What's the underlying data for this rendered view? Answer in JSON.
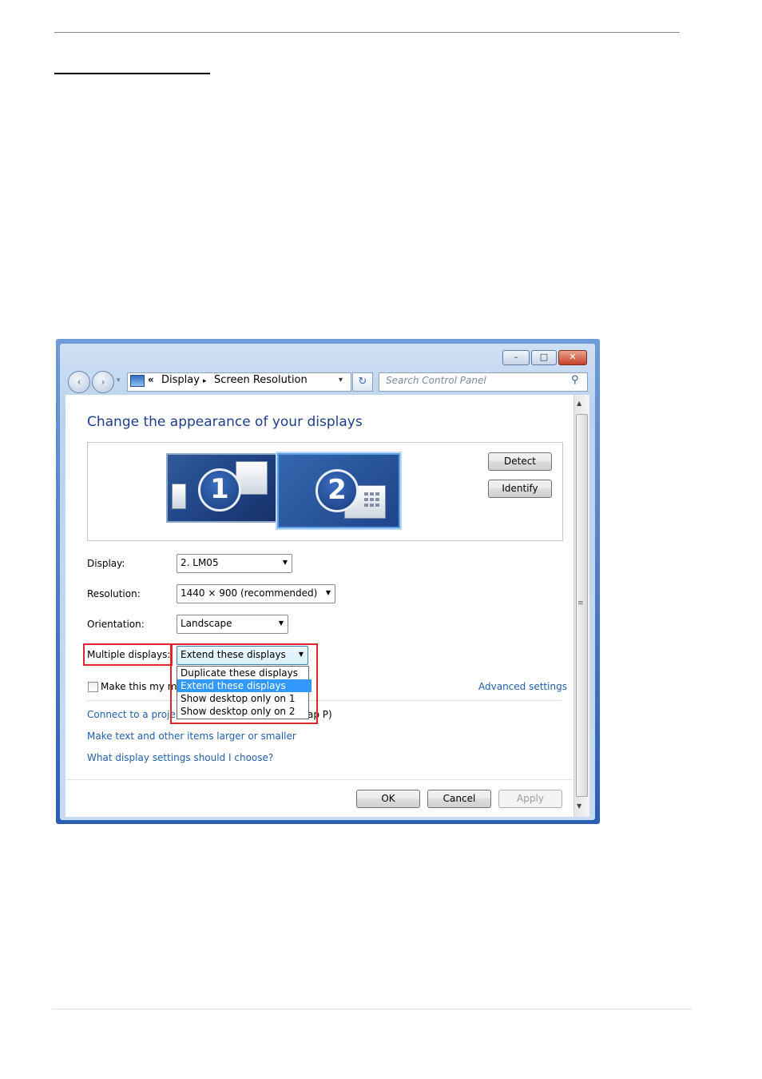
{
  "titlebar": {
    "minimize_glyph": "–",
    "maximize_glyph": "□",
    "close_glyph": "✕"
  },
  "nav": {
    "back_glyph": "‹",
    "forward_glyph": "›",
    "history_glyph": "▾",
    "breadcrumb_chevron": "«",
    "breadcrumb": [
      "Display",
      "Screen Resolution"
    ],
    "breadcrumb_separator": "▸",
    "address_dropdown_glyph": "▾",
    "refresh_glyph": "↻",
    "search_placeholder": "Search Control Panel",
    "search_glyph": "⚲"
  },
  "main": {
    "title": "Change the appearance of your displays",
    "monitors": [
      {
        "number": "1",
        "selected": false
      },
      {
        "number": "2",
        "selected": true
      }
    ],
    "detect_label": "Detect",
    "identify_label": "Identify"
  },
  "settings": {
    "display": {
      "label": "Display:",
      "value": "2. LM05"
    },
    "resolution": {
      "label": "Resolution:",
      "value": "1440 × 900 (recommended)"
    },
    "orientation": {
      "label": "Orientation:",
      "value": "Landscape"
    },
    "multiple_displays": {
      "label": "Multiple displays:",
      "value": "Extend these displays",
      "options": [
        "Duplicate these displays",
        "Extend these displays",
        "Show desktop only on 1",
        "Show desktop only on 2"
      ],
      "highlighted_index": 1
    },
    "select_arrow": "▼"
  },
  "checkbox_label": "Make this my ma",
  "advanced_settings": "Advanced settings",
  "links": {
    "connect_projector": "Connect to a proje",
    "connect_projector_tail": "ap P)",
    "text_size": "Make text and other items larger or smaller",
    "which_settings": "What display settings should I choose?"
  },
  "footer": {
    "ok": "OK",
    "cancel": "Cancel",
    "apply": "Apply"
  },
  "scroll": {
    "up_glyph": "▲",
    "down_glyph": "▼",
    "grip_glyph": "≡"
  },
  "colors": {
    "highlight_box": "#e0262c",
    "link": "#1f5fae",
    "title": "#1e3e8c",
    "selection": "#3399ff"
  }
}
